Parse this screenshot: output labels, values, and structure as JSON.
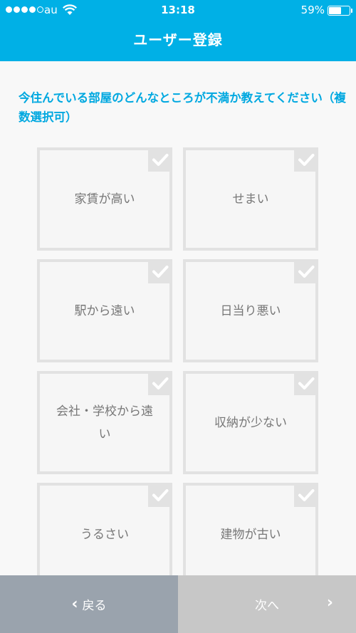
{
  "status_bar": {
    "carrier": "au",
    "time": "13:18",
    "battery_percent": "59%",
    "battery_level": 0.59,
    "signal_bars_filled": 4,
    "signal_bars_total": 5
  },
  "header": {
    "title": "ユーザー登録"
  },
  "question": {
    "text": "今住んでいる部屋のどんなところが不満か教えてください（複数選択可）"
  },
  "options": [
    {
      "label": "家賃が高い"
    },
    {
      "label": "せまい"
    },
    {
      "label": "駅から遠い"
    },
    {
      "label": "日当り悪い"
    },
    {
      "label": "会社・学校から遠い"
    },
    {
      "label": "収納が少ない"
    },
    {
      "label": "うるさい"
    },
    {
      "label": "建物が古い"
    }
  ],
  "footer": {
    "back_label": "戻る",
    "next_label": "次へ"
  },
  "colors": {
    "accent": "#00b0e6",
    "back_button": "#9aa3ad",
    "next_button_disabled": "#c7c7c7"
  },
  "icons": {
    "check": "checkmark-icon",
    "back": "chevron-left-icon",
    "next": "chevron-right-icon"
  }
}
